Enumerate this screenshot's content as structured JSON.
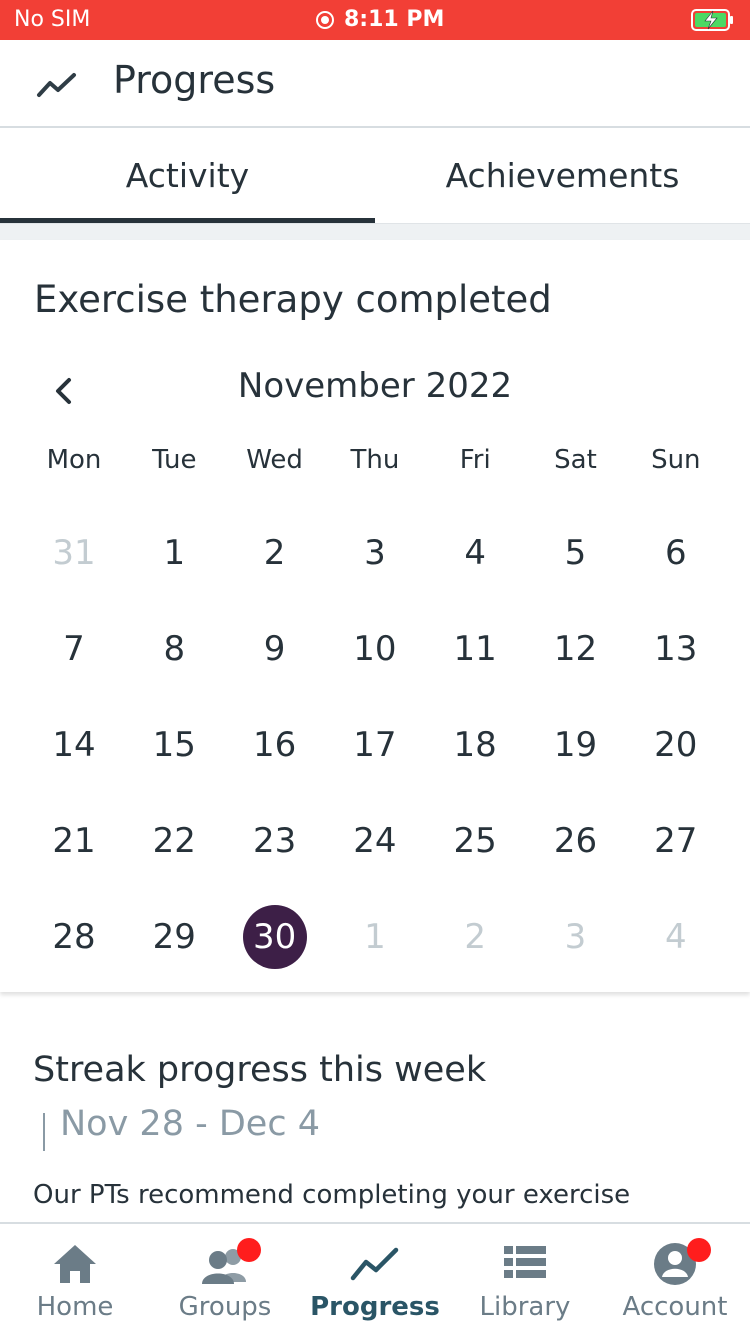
{
  "status_bar": {
    "carrier": "No SIM",
    "time": "8:11 PM"
  },
  "header": {
    "title": "Progress",
    "icon": "trend-line-icon"
  },
  "tabs": [
    {
      "label": "Activity",
      "active": true
    },
    {
      "label": "Achievements",
      "active": false
    }
  ],
  "calendar": {
    "section_title": "Exercise therapy completed",
    "month_label": "November 2022",
    "weekdays": [
      "Mon",
      "Tue",
      "Wed",
      "Thu",
      "Fri",
      "Sat",
      "Sun"
    ],
    "weeks": [
      [
        {
          "d": "31",
          "muted": true
        },
        {
          "d": "1"
        },
        {
          "d": "2"
        },
        {
          "d": "3"
        },
        {
          "d": "4"
        },
        {
          "d": "5"
        },
        {
          "d": "6"
        }
      ],
      [
        {
          "d": "7"
        },
        {
          "d": "8"
        },
        {
          "d": "9"
        },
        {
          "d": "10"
        },
        {
          "d": "11"
        },
        {
          "d": "12"
        },
        {
          "d": "13"
        }
      ],
      [
        {
          "d": "14"
        },
        {
          "d": "15"
        },
        {
          "d": "16"
        },
        {
          "d": "17"
        },
        {
          "d": "18"
        },
        {
          "d": "19"
        },
        {
          "d": "20"
        }
      ],
      [
        {
          "d": "21"
        },
        {
          "d": "22"
        },
        {
          "d": "23"
        },
        {
          "d": "24"
        },
        {
          "d": "25"
        },
        {
          "d": "26"
        },
        {
          "d": "27"
        }
      ],
      [
        {
          "d": "28"
        },
        {
          "d": "29"
        },
        {
          "d": "30",
          "selected": true
        },
        {
          "d": "1",
          "muted": true
        },
        {
          "d": "2",
          "muted": true
        },
        {
          "d": "3",
          "muted": true
        },
        {
          "d": "4",
          "muted": true
        }
      ]
    ],
    "selected_color": "#3d1f47"
  },
  "streak": {
    "title": "Streak progress this week",
    "range": "Nov 28 - Dec 4",
    "description": "Our PTs recommend completing your exercise"
  },
  "bottom_nav": [
    {
      "label": "Home",
      "icon": "home-icon",
      "active": false,
      "badge": false
    },
    {
      "label": "Groups",
      "icon": "groups-icon",
      "active": false,
      "badge": true
    },
    {
      "label": "Progress",
      "icon": "trend-line-icon",
      "active": true,
      "badge": false
    },
    {
      "label": "Library",
      "icon": "library-list-icon",
      "active": false,
      "badge": false
    },
    {
      "label": "Account",
      "icon": "account-icon",
      "active": false,
      "badge": true
    }
  ],
  "colors": {
    "status_bar": "#f23f36",
    "text": "#27323a",
    "muted": "#c3ccd1",
    "badge": "#ff1d1d",
    "nav_active": "#2a5566"
  }
}
